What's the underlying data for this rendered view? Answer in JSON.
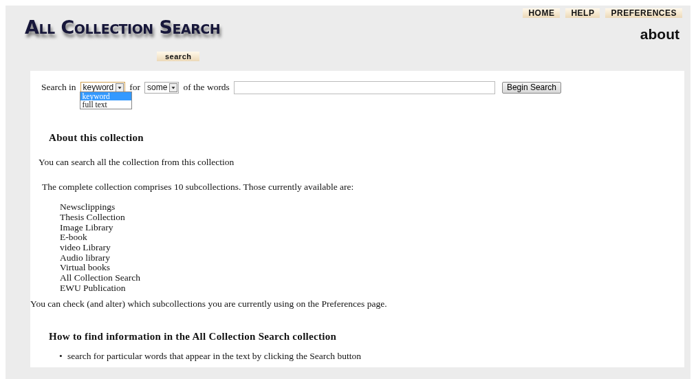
{
  "header": {
    "logo": "All Collection Search",
    "nav": [
      "HOME",
      "HELP",
      "PREFERENCES"
    ],
    "page_title": "about",
    "search_tab": "search"
  },
  "search_form": {
    "label_in": "Search in",
    "field_select": {
      "value": "keyword",
      "expanded": true,
      "options": [
        {
          "label": "keyword",
          "selected": true
        },
        {
          "label": "full text",
          "selected": false
        }
      ]
    },
    "label_for": "for",
    "mode_select": {
      "value": "some",
      "expanded": false
    },
    "label_words": "of the words",
    "button": "Begin Search"
  },
  "about": {
    "heading": "About this collection",
    "intro": "You can search all the collection from this collection",
    "summary": "The complete collection comprises 10 subcollections. Those currently available are:",
    "subcollections": [
      "Newsclippings",
      "Thesis Collection",
      "Image Library",
      "E-book",
      "video Library",
      "Audio library",
      "Virtual books",
      "All Collection Search",
      "EWU Publication"
    ],
    "preferences_note": "You can check (and alter) which subcollections you are currently using on the Preferences page."
  },
  "howto": {
    "heading": "How to find information in the All Collection Search collection",
    "tips": [
      {
        "bullet": "•",
        "text": "search for particular words that appear in the text by clicking the Search button"
      }
    ]
  }
}
